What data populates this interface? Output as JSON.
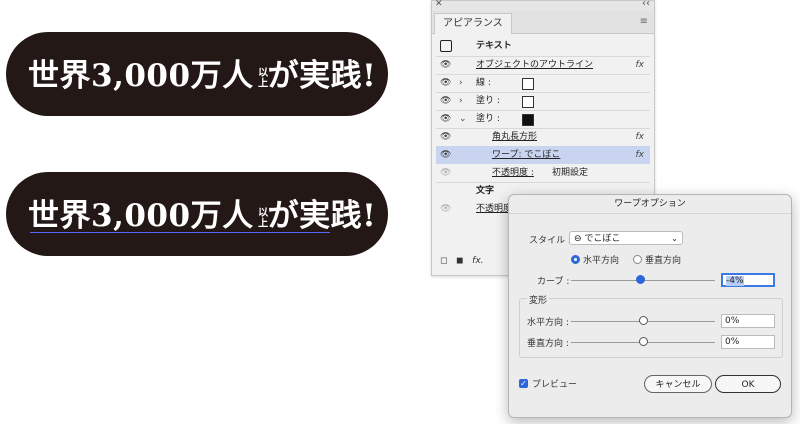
{
  "artwork": {
    "headline_a": "世界3,000万人",
    "headline_suffix": "以上",
    "headline_b": "が実践!"
  },
  "appearance_panel": {
    "tab_label": "アピアランス",
    "header": "テキスト",
    "rows": [
      {
        "label": "オブジェクトのアウトライン",
        "fx": "fx"
      },
      {
        "label": "線 :"
      },
      {
        "label": "塗り :"
      },
      {
        "label": "塗り :"
      },
      {
        "label": "角丸長方形",
        "fx": "fx"
      },
      {
        "label": "ワープ: でこぼこ",
        "fx": "fx"
      },
      {
        "label": "不透明度 :",
        "value": "初期設定"
      },
      {
        "label": "文字"
      },
      {
        "label": "不透明度 :"
      }
    ],
    "fx_footer": "fx."
  },
  "warp_dialog": {
    "title": "ワープオプション",
    "style_label": "スタイル :",
    "style_value": "⊖ でこぼこ",
    "horizontal": "水平方向",
    "vertical": "垂直方向",
    "curve_label": "カーブ :",
    "curve_value": "-4%",
    "distort_group": "変形",
    "dist_h_label": "水平方向 :",
    "dist_h_value": "0%",
    "dist_v_label": "垂直方向 :",
    "dist_v_value": "0%",
    "preview_label": "プレビュー",
    "cancel": "キャンセル",
    "ok": "OK"
  },
  "colors": {
    "pill": "#231815",
    "highlight_row": "#c8d4f0",
    "accent": "#2c66d8"
  }
}
